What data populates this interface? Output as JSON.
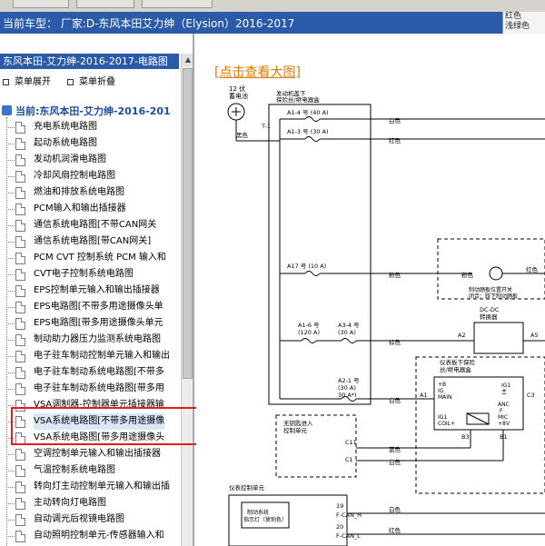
{
  "header": {
    "current_model": "当前车型：  厂家:D-东风本田艾力绅（Elysion）2016-2017",
    "right_labels": [
      "红色",
      "浅绿色"
    ]
  },
  "sidebar": {
    "panel_title": "东风本田-艾力绅-2016-2017-电路图",
    "expand_label": "菜单展开",
    "collapse_label": "菜单折叠",
    "root_label": "当前:东风本田-艾力绅-2016-201",
    "items": [
      "充电系统电路图",
      "起动系统电路图",
      "发动机润滑电路图",
      "冷却风扇控制电路图",
      "燃油和排放系统电路图",
      "PCM输入和输出插接器",
      "通信系统电路图[不带CAN网关",
      "通信系统电路图[带CAN网关]",
      "PCM CVT 控制系统 PCM 输入和",
      "CVT电子控制系统电路图",
      "EPS控制单元输入和输出插接器",
      "EPS电路图[不带多用途摄像头单",
      "EPS电路图[带多用途摄像头单元",
      "制动助力器压力监测系统电路图",
      "电子驻车制动控制单元输入和输出",
      "电子驻车制动系统电路图[不带多",
      "电子驻车制动系统电路图[带多用",
      "VSA调制器-控制器单元插接器输",
      "VSA系统电路图[不带多用途摄像",
      "VSA系统电路图[带多用途摄像头",
      "空调控制单元输入和输出插接器",
      "气温控制系统电路图",
      "转向灯主动控制单元输入和输出插",
      "主动转向灯电路图",
      "自动调光后视镜电路图",
      "自动照明控制单元-传感器输入和"
    ],
    "selected_index": 18
  },
  "diagram": {
    "view_large_link": "[点击查看大图]",
    "battery": {
      "voltage": "12 伏",
      "name": "蓄电池"
    },
    "fuse_box": {
      "line1": "发动机盖下",
      "line2": "保险丝/继电器盒"
    },
    "t1": "T-1",
    "black": "黑色",
    "fuses": [
      {
        "line1": "A1-4 号 (40 A)",
        "line2": "",
        "wire": "白色"
      },
      {
        "line1": "A1-3 号 (30 A)",
        "line2": "",
        "wire": "红色"
      },
      {
        "line1": "A17 号 (10 A)",
        "line2": "",
        "wire": "粉色"
      },
      {
        "line1": "A1-6 号",
        "line2": "(120 A)",
        "wire": "棕色"
      },
      {
        "line1": "A3-4 号",
        "line2": "(30 A)",
        "wire": ""
      },
      {
        "line1": "A2-1 号",
        "line2": "(30 A)",
        "wire": "白色"
      }
    ],
    "fuse_a21_extra": "30 A*)",
    "brake_switch": {
      "wire": "粉色",
      "red": "红色",
      "line1": "制动踏板位置开关",
      "line2": "闭合：踩下制动踏板"
    },
    "dcdc": {
      "title": "DC-DC",
      "subtitle": "转换器",
      "a2": "A2",
      "a5": "A5"
    },
    "dash_fuse": {
      "line1": "仪表板下保险",
      "line2": "丝/继电器盒",
      "a1": "A1",
      "c3": "C3",
      "p8": "+B",
      "ig": "IG",
      "main": "MAIN",
      "ig1": "IG1",
      "ig1_main": "主",
      "anc": "ANC",
      "f": "F",
      "mic": "MIC",
      "b8v": "+8V",
      "ig1b": "IG1",
      "coil": "COIL+",
      "b3": "B3",
      "b1": "B1"
    },
    "motor_control": {
      "line1": "无钥匙进入",
      "line2": "控制单元",
      "c11": "C11",
      "c1": "C1",
      "blue": "蓝色",
      "white": "白色"
    },
    "meter": {
      "title": "仪表控制单元",
      "indicator1": "制动系统",
      "indicator2": "指示灯（琥珀色）",
      "pin19": "19",
      "canh": "F-CAN_H",
      "pin20": "20",
      "canl": "F-CAN_L",
      "wire1": "白色",
      "wire2": "红色"
    }
  },
  "colors": {
    "header_blue": "#2a5aa8",
    "tree_root": "#1a4fa3",
    "highlight": "#e31b23",
    "link": "#e07a00"
  }
}
